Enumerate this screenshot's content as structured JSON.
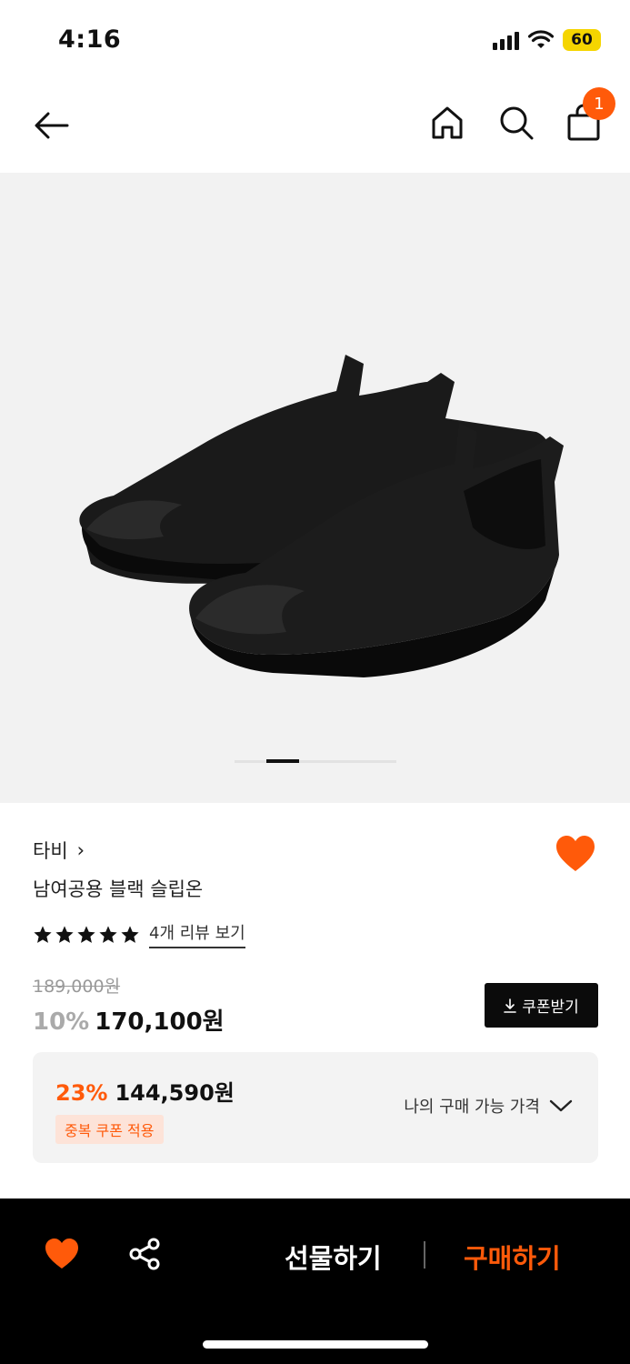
{
  "status_bar": {
    "time": "4:16",
    "battery": "60",
    "icons": [
      "signal-icon",
      "wifi-icon",
      "battery-icon"
    ]
  },
  "nav": {
    "icons": [
      "back-arrow-icon",
      "home-icon",
      "search-icon",
      "cart-icon"
    ],
    "cart_count": "1"
  },
  "gallery": {
    "image": "black-slip-on-tabi-shoes",
    "background": "#f2f2f2"
  },
  "product": {
    "brand": "타비",
    "brand_chevron": "›",
    "name": "남여공용 블랙 슬립온",
    "rating": 5,
    "review_link": "4개 리뷰 보기",
    "original_price": "189,000원",
    "discount_percent": "10%",
    "sale_price": "170,100원",
    "coupon_button": "쿠폰받기"
  },
  "best_price": {
    "percent": "23%",
    "price": "144,590원",
    "badge": "중복 쿠폰 적용",
    "toggle_label": "나의 구매 가능 가격"
  },
  "bottom_bar": {
    "gift": "선물하기",
    "buy": "구매하기"
  },
  "colors": {
    "accent": "#ff5a0a",
    "dark": "#000000",
    "badge_bg": "#fde3d8"
  }
}
